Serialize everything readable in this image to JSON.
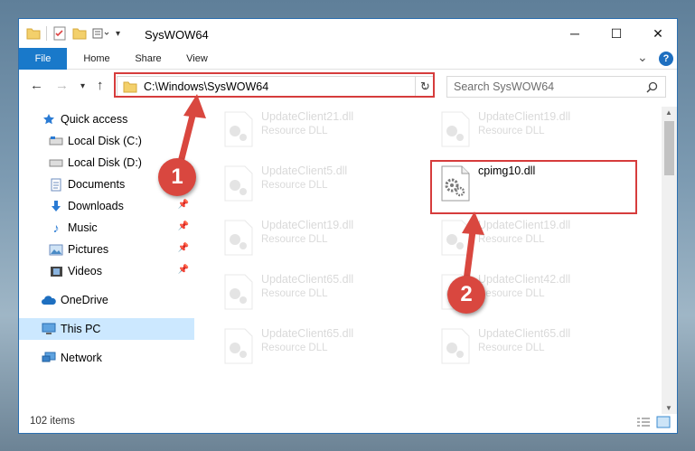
{
  "window": {
    "title": "SysWOW64",
    "minimize_glyph": "─",
    "maximize_glyph": "☐",
    "close_glyph": "✕"
  },
  "ribbon": {
    "tabs": [
      {
        "label": "File"
      },
      {
        "label": "Home"
      },
      {
        "label": "Share"
      },
      {
        "label": "View"
      }
    ],
    "chevron": "⌄",
    "help": "?"
  },
  "navbar": {
    "address": "C:\\Windows\\SysWOW64",
    "search_placeholder": "Search SysWOW64"
  },
  "sidebar": {
    "items": [
      {
        "label": "Quick access",
        "icon": "star-icon",
        "color": "#2a7bd4"
      },
      {
        "label": "Local Disk (C:)",
        "icon": "drive-icon"
      },
      {
        "label": "Local Disk (D:)",
        "icon": "drive-icon"
      },
      {
        "label": "Documents",
        "icon": "documents-icon"
      },
      {
        "label": "Downloads",
        "icon": "download-icon"
      },
      {
        "label": "Music",
        "icon": "music-icon"
      },
      {
        "label": "Pictures",
        "icon": "pictures-icon"
      },
      {
        "label": "Videos",
        "icon": "videos-icon"
      },
      {
        "label": "OneDrive",
        "icon": "cloud-icon"
      },
      {
        "label": "This PC",
        "icon": "pc-icon"
      },
      {
        "label": "Network",
        "icon": "network-icon"
      }
    ]
  },
  "files": [
    {
      "name": "UpdateClient21.dll",
      "type": "Resource DLL"
    },
    {
      "name": "UpdateClient19.dll",
      "type": "Resource DLL"
    },
    {
      "name": "UpdateClient5.dll",
      "type": "Resource DLL"
    },
    {
      "name": "cpimg10.dll",
      "type": ""
    },
    {
      "name": "UpdateClient19.dll",
      "type": "Resource DLL"
    },
    {
      "name": "UpdateClient19.dll",
      "type": "Resource DLL"
    },
    {
      "name": "UpdateClient65.dll",
      "type": "Resource DLL"
    },
    {
      "name": "UpdateClient42.dll",
      "type": "Resource DLL"
    },
    {
      "name": "UpdateClient65.dll",
      "type": "Resource DLL"
    },
    {
      "name": "UpdateClient65.dll",
      "type": "Resource DLL"
    }
  ],
  "status": {
    "items_count": "102 items"
  },
  "annotations": {
    "step1": "1",
    "step2": "2",
    "color": "#d63c3c"
  }
}
